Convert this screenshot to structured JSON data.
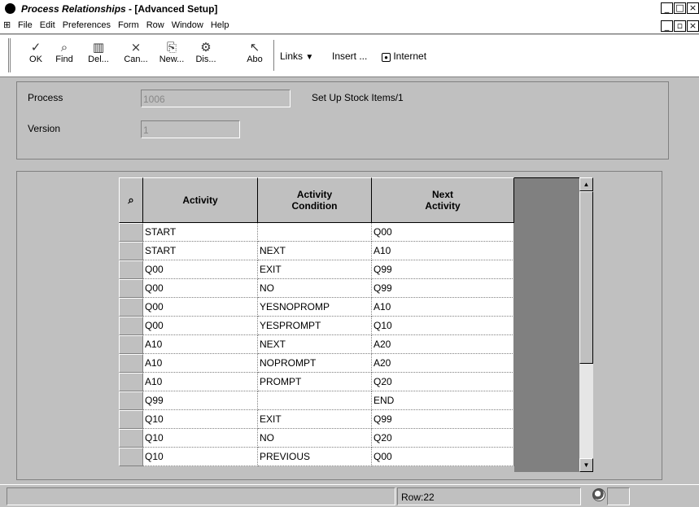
{
  "window": {
    "title_italic": "Process Relationships",
    "title_rest": " - [Advanced Setup]",
    "buttons": [
      "_",
      "□",
      "×"
    ]
  },
  "menu": {
    "items": [
      "File",
      "Edit",
      "Preferences",
      "Form",
      "Row",
      "Window",
      "Help"
    ],
    "mdi_buttons": [
      "_",
      "▫",
      "×"
    ]
  },
  "toolbar": {
    "buttons": [
      {
        "label": "OK",
        "icon": "check-icon",
        "glyph": "✓"
      },
      {
        "label": "Find",
        "icon": "find-icon",
        "glyph": "🔍"
      },
      {
        "label": "Del...",
        "icon": "trash-icon",
        "glyph": "🗑"
      },
      {
        "label": "Can...",
        "icon": "cancel-icon",
        "glyph": "×"
      },
      {
        "label": "New...",
        "icon": "new-icon",
        "glyph": "⎘"
      },
      {
        "label": "Dis...",
        "icon": "display-icon",
        "glyph": "⚙"
      },
      {
        "label": "Abo",
        "icon": "about-icon",
        "glyph": "↖"
      }
    ],
    "links_label": "Links",
    "insert_label": "Insert ...",
    "internet_label": "Internet"
  },
  "form": {
    "process_label": "Process",
    "process_value": "1006",
    "process_description": "Set Up Stock Items/1",
    "version_label": "Version",
    "version_value": "1"
  },
  "grid": {
    "headers": {
      "activity": "Activity",
      "activity_condition": "Activity Condition",
      "next_activity": "Next Activity"
    },
    "rows": [
      [
        "START",
        "",
        "Q00"
      ],
      [
        "START",
        "NEXT",
        "A10"
      ],
      [
        "Q00",
        "EXIT",
        "Q99"
      ],
      [
        "Q00",
        "NO",
        "Q99"
      ],
      [
        "Q00",
        "YESNOPROMP",
        "A10"
      ],
      [
        "Q00",
        "YESPROMPT",
        "Q10"
      ],
      [
        "A10",
        "NEXT",
        "A20"
      ],
      [
        "A10",
        "NOPROMPT",
        "A20"
      ],
      [
        "A10",
        "PROMPT",
        "Q20"
      ],
      [
        "Q99",
        "",
        "END"
      ],
      [
        "Q10",
        "EXIT",
        "Q99"
      ],
      [
        "Q10",
        "NO",
        "Q20"
      ],
      [
        "Q10",
        "PREVIOUS",
        "Q00"
      ]
    ]
  },
  "status": {
    "row_text": "Row:22"
  }
}
